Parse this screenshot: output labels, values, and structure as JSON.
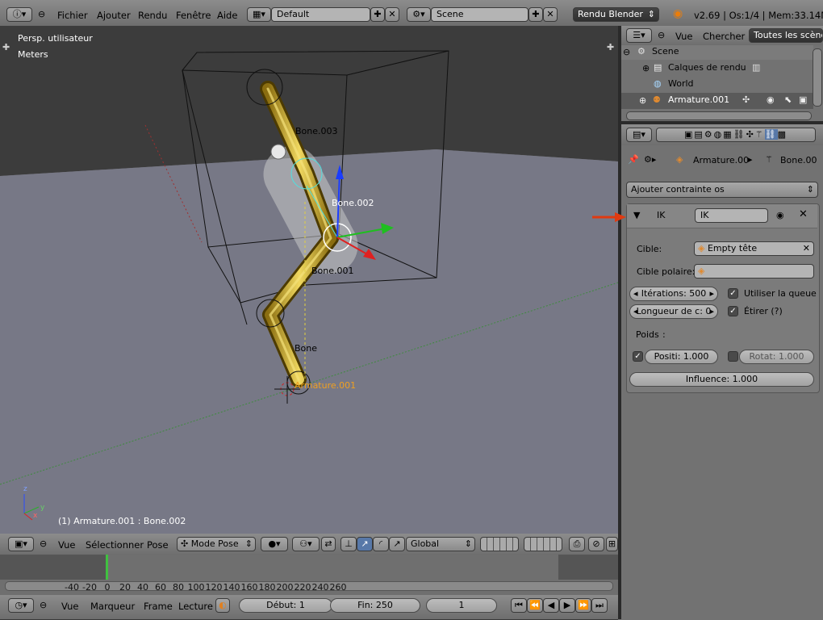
{
  "top_menu": {
    "items": [
      "Fichier",
      "Ajouter",
      "Rendu",
      "Fenêtre",
      "Aide"
    ],
    "screen_layout": "Default",
    "scene": "Scene",
    "render_engine": "Rendu Blender",
    "stats": "v2.69 | Os:1/4 | Mem:33.14M ("
  },
  "viewport": {
    "view_label": "Persp. utilisateur",
    "units_label": "Meters",
    "bone_labels": [
      "Bone.003",
      "Bone.002",
      "Bone.001",
      "Bone"
    ],
    "armature_label": "Armature.001",
    "status": "(1) Armature.001 : Bone.002",
    "axis_z": "z",
    "axis_y": "y",
    "axis_x": "x"
  },
  "view3d_header": {
    "menus": [
      "Vue",
      "Sélectionner",
      "Pose"
    ],
    "mode": "Mode Pose",
    "orientation": "Global"
  },
  "timeline": {
    "ticks": [
      "-40",
      "-20",
      "0",
      "20",
      "40",
      "60",
      "80",
      "100",
      "120",
      "140",
      "160",
      "180",
      "200",
      "220",
      "240",
      "260"
    ],
    "menus": [
      "Vue",
      "Marqueur",
      "Frame",
      "Lecture"
    ],
    "start": "Début: 1",
    "end": "Fin: 250",
    "current": "1"
  },
  "outliner": {
    "menus": [
      "Vue",
      "Chercher"
    ],
    "filter": "Toutes les scènes",
    "items": [
      "Scene",
      "Calques de rendu",
      "World",
      "Armature.001"
    ]
  },
  "properties": {
    "breadcrumb_object": "Armature.00",
    "breadcrumb_bone": "Bone.00",
    "add_constraint": "Ajouter contrainte os",
    "constraint": {
      "type": "IK",
      "name": "IK",
      "target_label": "Cible:",
      "target_value": "Empty tête",
      "pole_label": "Cible polaire:",
      "iterations": "Itérations: 500",
      "use_tail": "Utiliser la queue",
      "chain_length": "Longueur de c: 0",
      "stretch": "Étirer (?)",
      "weight_label": "Poids",
      "weight_colon": ":",
      "position": "Positi: 1.000",
      "rotation": "Rotat: 1.000",
      "influence": "Influence: 1.000"
    }
  },
  "colors": {
    "viewport_bg": "#727272",
    "floor": "#777886",
    "bone_yellow": "#d4b43a",
    "annotation_arrow": "#e03a10"
  }
}
